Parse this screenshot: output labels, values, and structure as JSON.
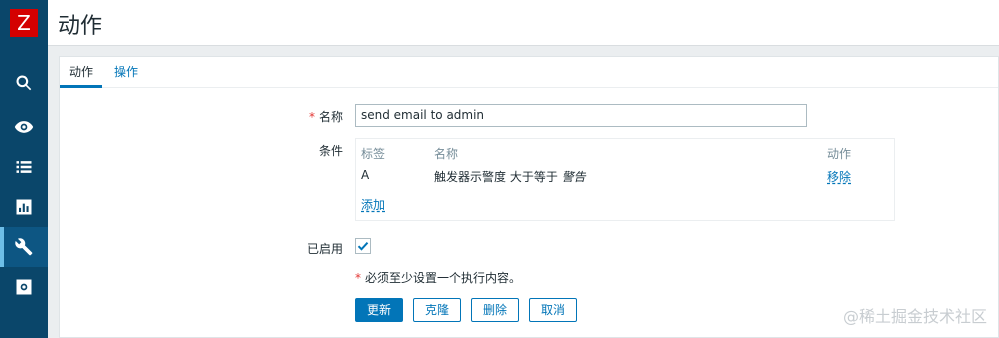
{
  "app": {
    "logo_letter": "Z",
    "page_title": "动作"
  },
  "sidebar": {
    "items": [
      {
        "icon": "search-icon"
      },
      {
        "icon": "eye-icon"
      },
      {
        "icon": "list-icon"
      },
      {
        "icon": "chart-icon"
      },
      {
        "icon": "wrench-icon",
        "active": true
      },
      {
        "icon": "gear-icon"
      }
    ]
  },
  "tabs": [
    {
      "label": "动作",
      "active": true
    },
    {
      "label": "操作",
      "active": false
    }
  ],
  "form": {
    "name_label": "名称",
    "name_required": "*",
    "name_value": "send email to admin",
    "conditions_label": "条件",
    "conditions": {
      "headers": {
        "tag": "标签",
        "name": "名称",
        "action": "动作"
      },
      "rows": [
        {
          "tag": "A",
          "name_prefix": "触发器示警度 大于等于 ",
          "name_emph": "警告",
          "action": "移除"
        }
      ],
      "add_link": "添加"
    },
    "enabled_label": "已启用",
    "enabled": true,
    "required_note_mark": "*",
    "required_note": "必须至少设置一个执行内容。"
  },
  "buttons": {
    "update": "更新",
    "clone": "克隆",
    "delete": "删除",
    "cancel": "取消"
  },
  "watermark": "@稀土掘金技术社区",
  "colors": {
    "sidebar_bg": "#0a466a",
    "accent": "#0275b8",
    "logo_bg": "#d40000",
    "required": "#e33734"
  }
}
